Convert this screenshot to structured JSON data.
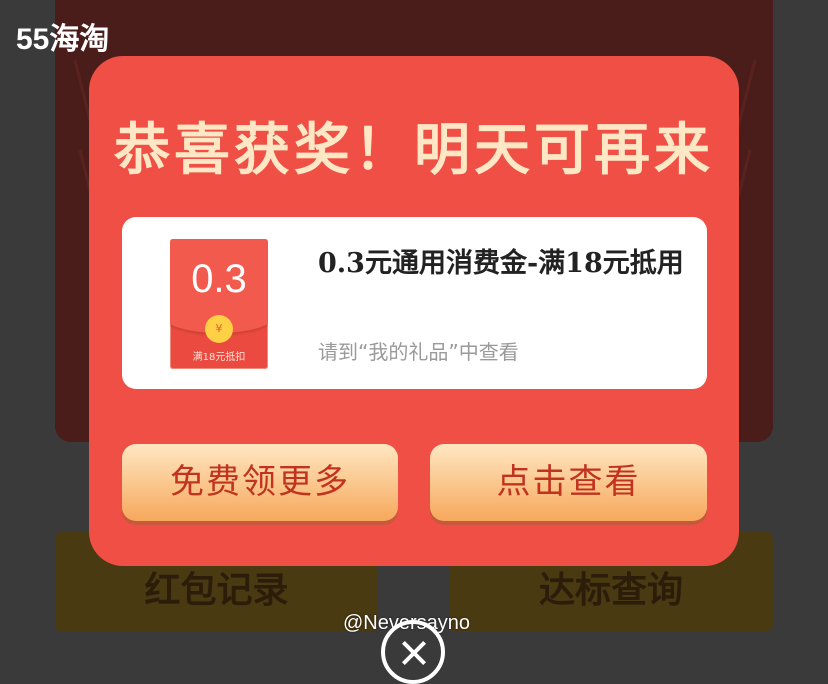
{
  "brand": {
    "logo_text": "55海淘"
  },
  "background": {
    "button_left": "红包记录",
    "button_right": "达标查询"
  },
  "modal": {
    "title": "恭喜获奖！明天可再来",
    "prize": {
      "coupon_value": "0.3",
      "coupon_currency_symbol": "¥",
      "coupon_note": "满18元抵扣",
      "name": "0.3元通用消费金-满18元抵用",
      "hint": "请到“我的礼品”中查看"
    },
    "buttons": {
      "get_more": "免费领更多",
      "view": "点击查看"
    }
  },
  "watermark": "@Neversayno",
  "icons": {
    "close": "close-icon",
    "coin": "yuan-coin-icon"
  },
  "colors": {
    "modal_red": "#ef4f45",
    "title_cream": "#fde7c4",
    "button_text": "#c2331f"
  }
}
